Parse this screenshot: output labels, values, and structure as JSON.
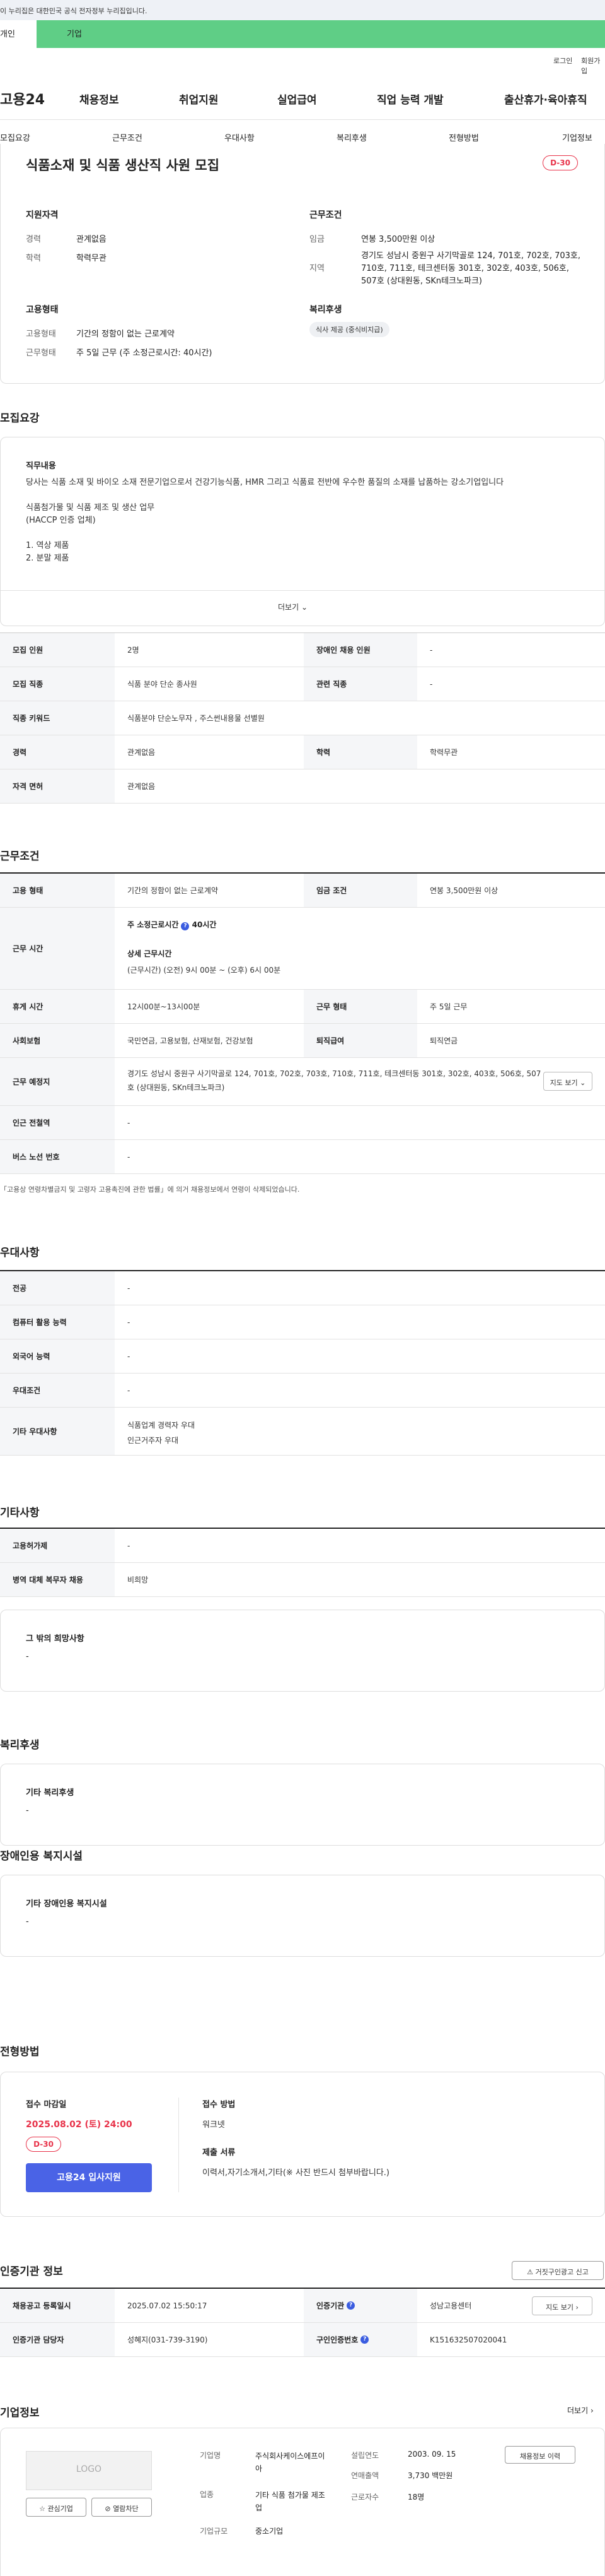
{
  "gov_banner": "이 누리집은 대한민국 공식 전자정부 누리집입니다.",
  "audience_tabs": {
    "person": "개인",
    "corp": "기업"
  },
  "util": {
    "login": "로그인",
    "signup": "회원가입"
  },
  "logo": "고용24",
  "gnb": [
    "채용정보",
    "취업지원",
    "실업급여",
    "직업 능력 개발",
    "출산휴가·육아휴직"
  ],
  "subnav": [
    "모집요강",
    "근무조건",
    "우대사항",
    "복리후생",
    "전형방법",
    "기업정보"
  ],
  "header": {
    "title": "식품소재 및 식품 생산직 사원 모집",
    "dday": "D-30",
    "qual_h": "지원자격",
    "career_l": "경력",
    "career_v": "관계없음",
    "edu_l": "학력",
    "edu_v": "학력무관",
    "cond_h": "근무조건",
    "wage_l": "임금",
    "wage_v": "연봉 3,500만원 이상",
    "area_l": "지역",
    "area_v": "경기도 성남시 중원구 사기막골로 124, 701호, 702호, 703호, 710호, 711호, 테크센터동 301호, 302호, 403호, 506호, 507호 (상대원동, SKn테크노파크)",
    "emp_h": "고용형태",
    "emptype_l": "고용형태",
    "emptype_v": "기간의 정함이 없는 근로계약",
    "worktype_l": "근무형태",
    "worktype_v": "주 5일 근무 (주 소정근로시간: 40시간)",
    "welfare_h": "복리후생",
    "welfare_pill": "식사 제공 (중식비지급)"
  },
  "recruit": {
    "title": "모집요강",
    "job_h": "직무내용",
    "job_text": [
      "당사는 식품 소재 및 바이오 소재 전문기업으로서 건강기능식품, HMR 그리고 식품료 전반에 우수한 품질의 소재를 납품하는 강소기업입니다",
      "",
      "식품첨가물 및 식품 제조 및 생산 업무",
      "(HACCP 인증 업체)",
      "",
      "1. 역상 제품",
      "2. 분말 제품"
    ],
    "more": "더보기",
    "rows": [
      [
        "모집 인원",
        "2명",
        "장애인 채용 인원",
        "-"
      ],
      [
        "모집 직종",
        "식품 분야 단순 종사원",
        "관련 직종",
        "-"
      ],
      [
        "직종 키워드",
        "식품분야 단순노무자 , 주스썬내용물 선별원",
        "",
        ""
      ],
      [
        "경력",
        "관계없음",
        "학력",
        "학력무관"
      ],
      [
        "자격 면허",
        "관계없음",
        "",
        ""
      ]
    ]
  },
  "work": {
    "title": "근무조건",
    "r1": [
      "고용 형태",
      "기간의 정함이 없는 근로계약",
      "임금 조건",
      "연봉 3,500만원 이상"
    ],
    "r2_h": "근무 시간",
    "r2_week": "주 소정근로시간",
    "r2_week_v": "40시간",
    "r2_detail_h": "상세 근무시간",
    "r2_detail": "(근무시간) (오전) 9시 00분 ~ (오후) 6시 00분",
    "r3": [
      "휴게 시간",
      "12시00분~13시00분",
      "근무 형태",
      "주 5일 근무"
    ],
    "r4": [
      "사회보험",
      "국민연금, 고용보험, 산재보험, 건강보험",
      "퇴직급여",
      "퇴직연금"
    ],
    "r5_h": "근무 예정지",
    "r5_v": "경기도 성남시 중원구 사기막골로 124, 701호, 702호, 703호, 710호, 711호, 테크센터동 301호, 302호, 403호, 506호, 507호 (상대원동, SKn테크노파크)",
    "r5_btn": "지도 보기",
    "r6": [
      "인근 전철역",
      "-"
    ],
    "r7": [
      "버스 노선 번호",
      "-"
    ],
    "note": "「고용상 연령차별금지 및 고령자 고용촉진에 관한 법률」에 의거 채용정보에서 연령이 삭제되었습니다."
  },
  "pref": {
    "title": "우대사항",
    "rows": [
      [
        "전공",
        "-"
      ],
      [
        "컴퓨터 활용 능력",
        "-"
      ],
      [
        "외국어 능력",
        "-"
      ],
      [
        "우대조건",
        "-"
      ]
    ],
    "other_h": "기타 우대사항",
    "other_v1": "식품업계 경력자 우대",
    "other_v2": "인근거주자 우대"
  },
  "etc": {
    "title": "기타사항",
    "rows": [
      [
        "고용허가제",
        "-"
      ],
      [
        "병역 대체 복무자 채용",
        "비희망"
      ]
    ],
    "wish_h": "그 밖의 희망사항",
    "wish_v": "-"
  },
  "welfare": {
    "title": "복리후생",
    "h": "기타 복리후생",
    "v": "-"
  },
  "disabled": {
    "title": "장애인용 복지시설",
    "h": "기타 장애인용 복지시설",
    "v": "-"
  },
  "process": {
    "title": "전형방법",
    "deadline_h": "접수 마감일",
    "deadline_v": "2025.08.02 (토) 24:00",
    "dday": "D-30",
    "apply_btn": "고용24 입사지원",
    "method_h": "접수 방법",
    "method_v": "워크넷",
    "docs_h": "제출 서류",
    "docs_v": "이력서,자기소개서,기타(※ 사진 반드시 첨부바랍니다.)"
  },
  "cert": {
    "title": "인증기관 정보",
    "report_btn": "거짓구인광고 신고",
    "r1": [
      "채용공고 등록일시",
      "2025.07.02 15:50:17",
      "인증기관",
      "성남고용센터"
    ],
    "r1_btn": "지도 보기",
    "r2": [
      "인증기관 담당자",
      "성혜지(031-739-3190)",
      "구인인증번호",
      "K151632507020041"
    ]
  },
  "company": {
    "title": "기업정보",
    "more": "더보기",
    "logo": "LOGO",
    "fav": "관심기업",
    "block": "열람차단",
    "name_l": "기업명",
    "name_v": "주식회사케이스에프이아",
    "founded_l": "설립연도",
    "founded_v": "2003. 09. 15",
    "jobs_btn": "채용정보 이력",
    "industry_l": "업종",
    "industry_v": "기타 식품 첨가물 제조업",
    "sales_l": "연매출액",
    "sales_v": "3,730 백만원",
    "emp_l": "근로자수",
    "emp_v": "18명",
    "scale_l": "기업규모",
    "scale_v": "중소기업"
  },
  "colors": {
    "accent_green": "#5fce86",
    "dday_red": "#e8334a",
    "apply_blue": "#4a63e6"
  }
}
